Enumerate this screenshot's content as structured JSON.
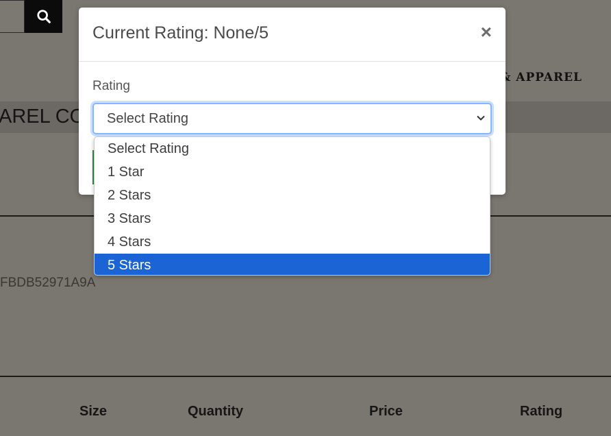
{
  "background": {
    "brand_text": "& APPAREL",
    "band_text": "AREL CO",
    "order_id_fragment": "FBDB52971A9A",
    "columns": [
      "Size",
      "Quantity",
      "Price",
      "Rating"
    ]
  },
  "modal": {
    "title": "Current Rating: None/5",
    "close_label": "×",
    "rating_label": "Rating",
    "select": {
      "value": "Select Rating",
      "options": [
        "Select Rating",
        "1 Star",
        "2 Stars",
        "3 Stars",
        "4 Stars",
        "5 Stars"
      ],
      "highlighted": "5 Stars"
    }
  },
  "colors": {
    "highlight": "#1a64d6",
    "focus_ring": "#86b7fe",
    "overlay": "#7a7670"
  }
}
